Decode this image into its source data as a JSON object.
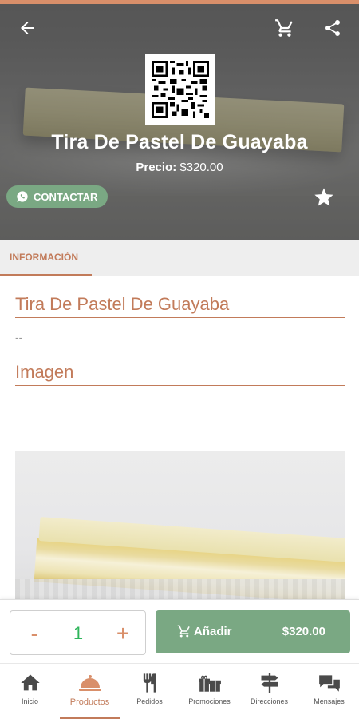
{
  "header": {
    "back_icon": "arrow-left-icon",
    "cart_icon": "cart-icon",
    "share_icon": "share-icon"
  },
  "product": {
    "title": "Tira De Pastel De Guayaba",
    "price_label": "Precio:",
    "price_value": "$320.00",
    "contact_label": "CONTACTAR",
    "favorite_icon": "star-icon"
  },
  "tabs": [
    {
      "label": "INFORMACIÓN",
      "active": true
    }
  ],
  "info": {
    "name_heading": "Tira De Pastel De Guayaba",
    "description": "--",
    "image_heading": "Imagen"
  },
  "cart_bar": {
    "minus": "-",
    "quantity": "1",
    "plus": "+",
    "add_label": "Añadir",
    "add_price": "$320.00"
  },
  "bottom_nav": [
    {
      "label": "Inicio",
      "icon": "home-icon"
    },
    {
      "label": "Productos",
      "icon": "cloche-icon",
      "active": true
    },
    {
      "label": "Pedidos",
      "icon": "utensils-icon"
    },
    {
      "label": "Promociones",
      "icon": "gifts-icon"
    },
    {
      "label": "Direcciones",
      "icon": "signpost-icon"
    },
    {
      "label": "Mensajes",
      "icon": "chat-bubbles-icon"
    }
  ],
  "colors": {
    "accent": "#c27b5a",
    "green": "#7aa883",
    "qty_green": "#2fb55b"
  }
}
